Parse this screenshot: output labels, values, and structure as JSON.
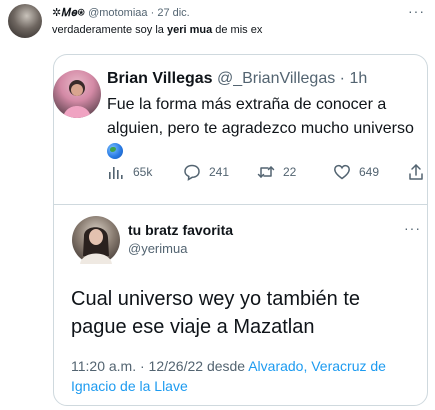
{
  "outer": {
    "display_name": "✲𝑀𝑒⍟",
    "handle": "@motomiaa",
    "separator": "·",
    "date": "27 dic.",
    "more": "···",
    "text_before": "verdaderamente soy la ",
    "text_bold": "yeri mua",
    "text_after": " de mis ex"
  },
  "middle": {
    "display_name": "Brian Villegas",
    "handle": "@_BrianVillegas",
    "separator": "·",
    "time": "1h",
    "text": "Fue la forma más extraña de conocer a alguien, pero te agradezco mucho universo",
    "emoji_icon": "globe-icon",
    "views": "65k",
    "replies": "241",
    "retweets": "22",
    "likes": "649"
  },
  "lower": {
    "display_name": "tu bratz favorita",
    "handle": "@yerimua",
    "more": "···",
    "text": "Cual universo wey yo también te pague ese viaje a Mazatlan",
    "timestamp": "11:20 a.m. · 12/26/22 desde ",
    "location": "Alvarado, Veracruz de Ignacio de la Llave"
  },
  "colors": {
    "text": "#0f1419",
    "muted": "#536471",
    "link": "#1d9bf0",
    "border": "#cfd9de"
  }
}
